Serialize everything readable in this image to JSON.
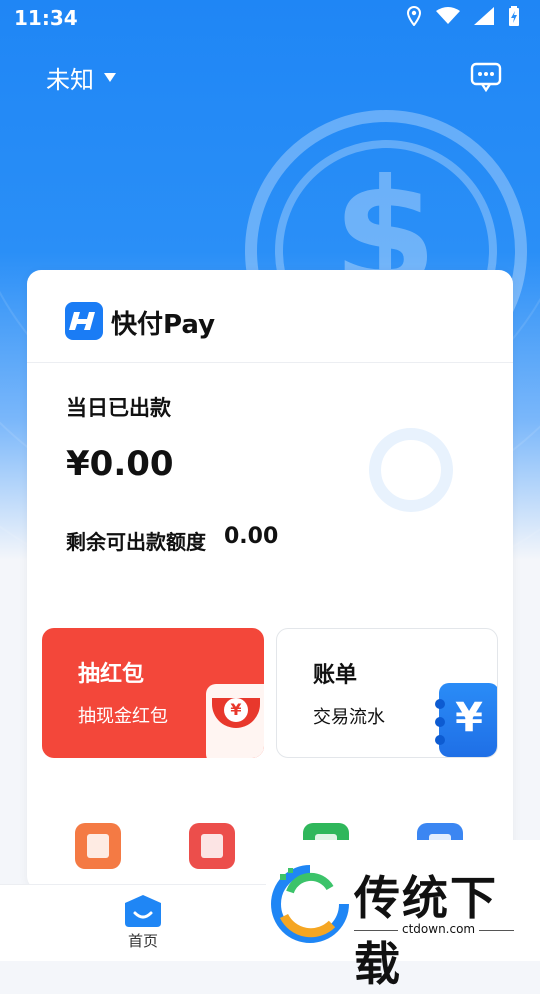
{
  "status_bar": {
    "time": "11:34",
    "icons": [
      "location-icon",
      "wifi-icon",
      "signal-icon",
      "battery-charging-icon"
    ]
  },
  "header": {
    "city": "未知",
    "message_icon": "chat-bubble-icon"
  },
  "card": {
    "brand_name": "快付Pay",
    "today_label": "当日已出款",
    "today_amount": "¥0.00",
    "quota_label": "剩余可出款额度",
    "quota_value": "0.00"
  },
  "tiles": [
    {
      "title": "抽红包",
      "subtitle": "抽现金红包",
      "icon": "red-envelope-icon"
    },
    {
      "title": "账单",
      "subtitle": "交易流水",
      "icon": "ledger-icon"
    }
  ],
  "colors": {
    "primary": "#1f86f5",
    "red_tile": "#f3473a",
    "text": "#111111"
  },
  "tabbar": {
    "home_label": "首页"
  },
  "watermark": {
    "title": "传统下载",
    "url": "ctdown.com"
  }
}
